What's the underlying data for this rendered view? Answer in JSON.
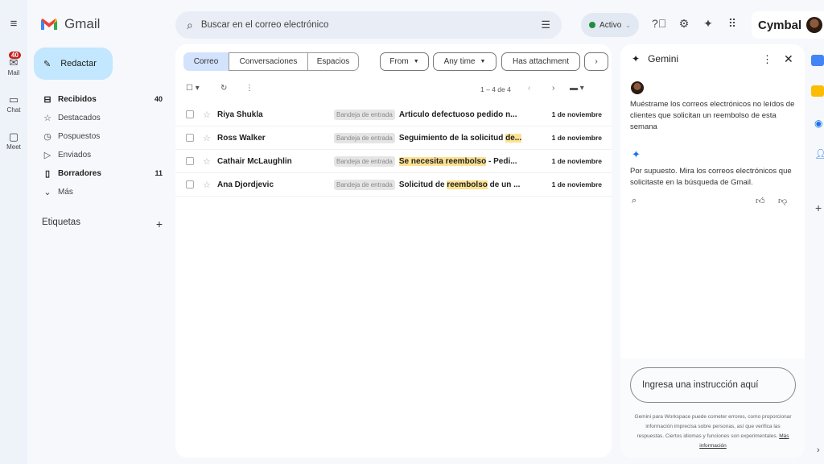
{
  "app": {
    "name": "Gmail",
    "brand": "Cymbal"
  },
  "rail": {
    "items": [
      {
        "label": "Mail",
        "badge": "40",
        "icon": "mail-icon"
      },
      {
        "label": "Chat",
        "icon": "chat-icon"
      },
      {
        "label": "Meet",
        "icon": "video-icon"
      }
    ]
  },
  "compose": {
    "label": "Redactar"
  },
  "nav": [
    {
      "label": "Recibidos",
      "count": "40",
      "icon": "inbox-icon"
    },
    {
      "label": "Destacados",
      "icon": "star-icon"
    },
    {
      "label": "Pospuestos",
      "icon": "clock-icon"
    },
    {
      "label": "Enviados",
      "icon": "send-icon"
    },
    {
      "label": "Borradores",
      "count": "11",
      "icon": "draft-icon"
    },
    {
      "label": "Más",
      "icon": "chevron-down-icon"
    }
  ],
  "labels": {
    "title": "Etiquetas"
  },
  "search": {
    "placeholder": "Buscar en el correo electrónico"
  },
  "status": {
    "label": "Activo",
    "color": "#1e8e3e"
  },
  "tabs": [
    "Correo",
    "Conversaciones",
    "Espacios"
  ],
  "chips": [
    "From",
    "Any time",
    "Has attachment"
  ],
  "toolbar": {
    "pagination": "1 – 4 de 4"
  },
  "emails": [
    {
      "sender": "Riya Shukla",
      "tag": "Bandeja de entrada",
      "subject_pre": "Articulo defectuoso pedido n...",
      "subject_hl": "",
      "subject_post": "",
      "date": "1 de noviembre"
    },
    {
      "sender": "Ross Walker",
      "tag": "Bandeja de entrada",
      "subject_pre": "Seguimiento de la solicitud ",
      "subject_hl": "de...",
      "subject_post": "",
      "date": "1 de noviembre"
    },
    {
      "sender": "Cathair McLaughlin",
      "tag": "Bandeja de entrada",
      "subject_pre": "",
      "subject_hl": "Se necesita reembolso",
      "subject_post": " - Pedi...",
      "date": "1 de noviembre"
    },
    {
      "sender": "Ana Djordjevic",
      "tag": "Bandeja de entrada",
      "subject_pre": "Solicitud de ",
      "subject_hl": "reembolso",
      "subject_post": " de un ...",
      "date": "1 de noviembre"
    }
  ],
  "gemini": {
    "title": "Gemini",
    "user_message": "Muéstrame los correos electrónicos no leídos de clientes que solicitan un reembolso de esta semana",
    "reply": "Por supuesto. Mira los correos electrónicos que solicitaste en la búsqueda de Gmail.",
    "prompt_placeholder": "Ingresa una instrucción aquí",
    "disclaimer": "Gemini para Workspace puede cometer errores, como proporcionar información imprecisa sobre personas, así que verifica las respuestas. Ciertos idiomas y funciones son experimentales.",
    "more_link": "Más información",
    "accent": "#1a73e8"
  }
}
